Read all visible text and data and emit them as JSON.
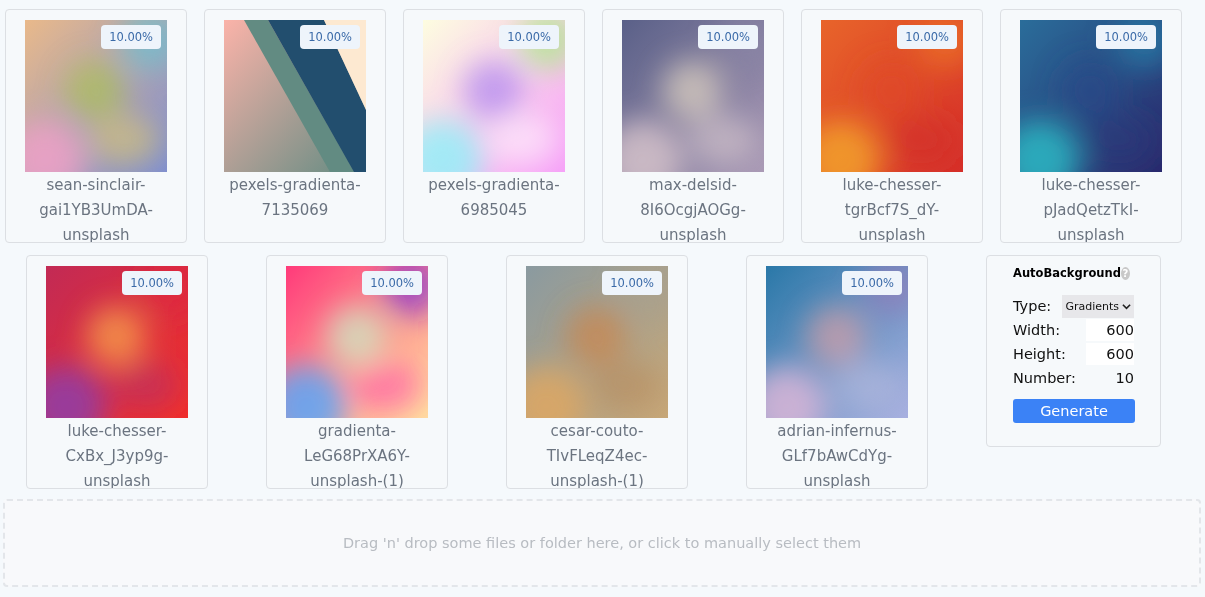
{
  "images": [
    {
      "label": "sean-sinclair-gai1YB3UmDA-unsplash",
      "badge": "10.00%"
    },
    {
      "label": "pexels-gradienta-7135069",
      "badge": "10.00%"
    },
    {
      "label": "pexels-gradienta-6985045",
      "badge": "10.00%"
    },
    {
      "label": "max-delsid-8I6OcgjAOGg-unsplash",
      "badge": "10.00%"
    },
    {
      "label": "luke-chesser-tgrBcf7S_dY-unsplash",
      "badge": "10.00%"
    },
    {
      "label": "luke-chesser-pJadQetzTkI-unsplash",
      "badge": "10.00%"
    },
    {
      "label": "luke-chesser-CxBx_J3yp9g-unsplash",
      "badge": "10.00%"
    },
    {
      "label": "gradienta-LeG68PrXA6Y-unsplash-(1)",
      "badge": "10.00%"
    },
    {
      "label": "cesar-couto-TIvFLeqZ4ec-unsplash-(1)",
      "badge": "10.00%"
    },
    {
      "label": "adrian-infernus-GLf7bAwCdYg-unsplash",
      "badge": "10.00%"
    }
  ],
  "panel": {
    "title": "AutoBackground",
    "help": "?",
    "fields": [
      {
        "kind": "select",
        "label": "Type:",
        "value": "Gradients"
      },
      {
        "kind": "input",
        "label": "Width:",
        "value": "600"
      },
      {
        "kind": "input",
        "label": "Height:",
        "value": "600"
      },
      {
        "kind": "plain",
        "label": "Number:",
        "value": "10"
      }
    ],
    "button": "Generate"
  },
  "dropzone": {
    "text": "Drag 'n' drop some files or folder here, or click to manually select them"
  }
}
